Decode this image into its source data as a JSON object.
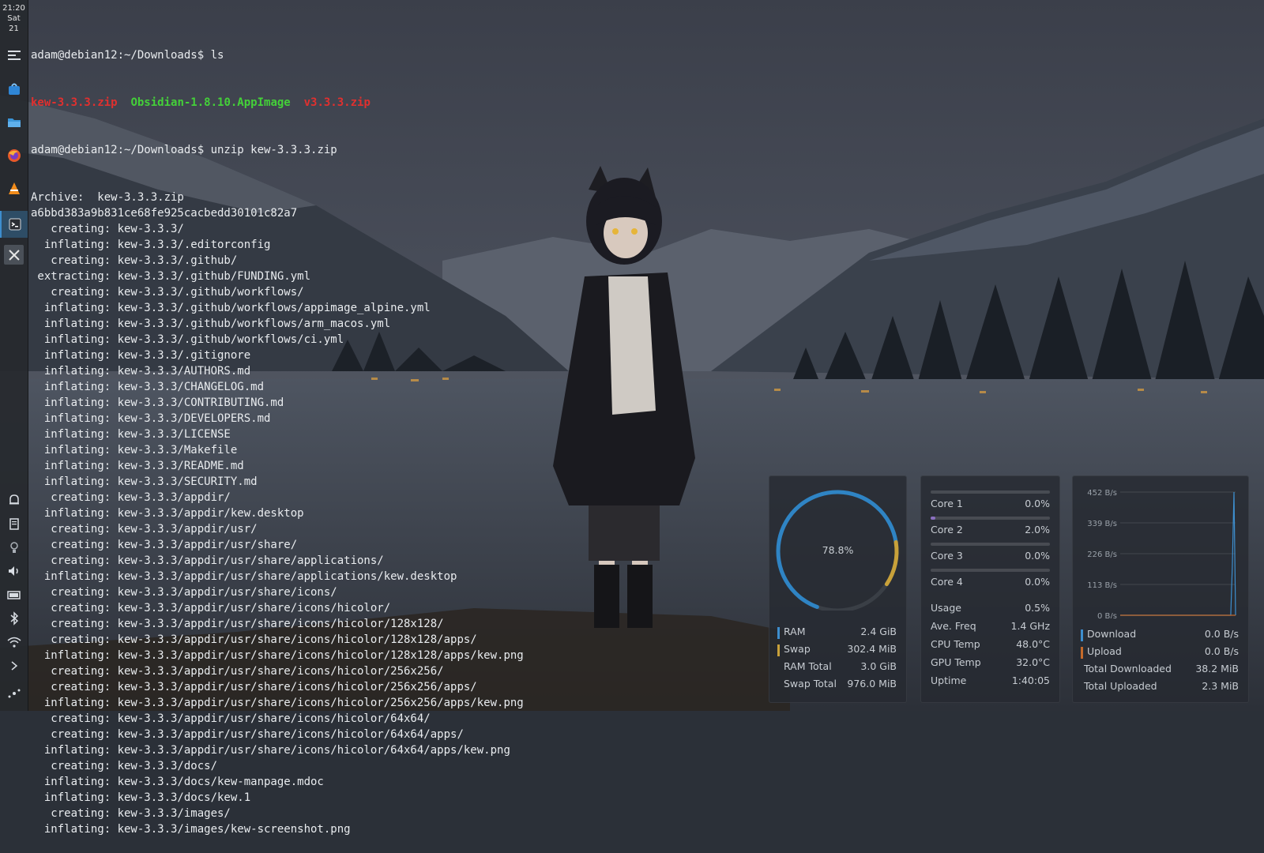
{
  "panel": {
    "clock": {
      "time": "21:20",
      "day": "Sat",
      "date": "21"
    },
    "launchers": [
      {
        "icon": "taskbar-settings-icon"
      },
      {
        "icon": "software-store-icon"
      },
      {
        "icon": "file-manager-icon"
      },
      {
        "icon": "firefox-icon"
      },
      {
        "icon": "vlc-icon"
      },
      {
        "icon": "terminal-icon"
      },
      {
        "icon": "xsnow-icon"
      }
    ],
    "tray": [
      {
        "icon": "notifications-icon"
      },
      {
        "icon": "clipboard-icon"
      },
      {
        "icon": "night-light-icon"
      },
      {
        "icon": "volume-icon"
      },
      {
        "icon": "battery-icon"
      },
      {
        "icon": "bluetooth-icon"
      },
      {
        "icon": "wifi-icon"
      },
      {
        "icon": "expand-tray-icon"
      },
      {
        "icon": "power-menu-icon"
      }
    ]
  },
  "terminal": {
    "prompt": "adam@debian12:~/Downloads$ ",
    "cmd_ls": "ls",
    "ls_output": [
      "kew-3.3.3.zip",
      "Obsidian-1.8.10.AppImage",
      "v3.3.3.zip"
    ],
    "cmd_unzip": "unzip kew-3.3.3.zip",
    "lines": [
      "Archive:  kew-3.3.3.zip",
      "a6bbd383a9b831ce68fe925cacbedd30101c82a7",
      "   creating: kew-3.3.3/",
      "  inflating: kew-3.3.3/.editorconfig",
      "   creating: kew-3.3.3/.github/",
      " extracting: kew-3.3.3/.github/FUNDING.yml",
      "   creating: kew-3.3.3/.github/workflows/",
      "  inflating: kew-3.3.3/.github/workflows/appimage_alpine.yml",
      "  inflating: kew-3.3.3/.github/workflows/arm_macos.yml",
      "  inflating: kew-3.3.3/.github/workflows/ci.yml",
      "  inflating: kew-3.3.3/.gitignore",
      "  inflating: kew-3.3.3/AUTHORS.md",
      "  inflating: kew-3.3.3/CHANGELOG.md",
      "  inflating: kew-3.3.3/CONTRIBUTING.md",
      "  inflating: kew-3.3.3/DEVELOPERS.md",
      "  inflating: kew-3.3.3/LICENSE",
      "  inflating: kew-3.3.3/Makefile",
      "  inflating: kew-3.3.3/README.md",
      "  inflating: kew-3.3.3/SECURITY.md",
      "   creating: kew-3.3.3/appdir/",
      "  inflating: kew-3.3.3/appdir/kew.desktop",
      "   creating: kew-3.3.3/appdir/usr/",
      "   creating: kew-3.3.3/appdir/usr/share/",
      "   creating: kew-3.3.3/appdir/usr/share/applications/",
      "  inflating: kew-3.3.3/appdir/usr/share/applications/kew.desktop",
      "   creating: kew-3.3.3/appdir/usr/share/icons/",
      "   creating: kew-3.3.3/appdir/usr/share/icons/hicolor/",
      "   creating: kew-3.3.3/appdir/usr/share/icons/hicolor/128x128/",
      "   creating: kew-3.3.3/appdir/usr/share/icons/hicolor/128x128/apps/",
      "  inflating: kew-3.3.3/appdir/usr/share/icons/hicolor/128x128/apps/kew.png",
      "   creating: kew-3.3.3/appdir/usr/share/icons/hicolor/256x256/",
      "   creating: kew-3.3.3/appdir/usr/share/icons/hicolor/256x256/apps/",
      "  inflating: kew-3.3.3/appdir/usr/share/icons/hicolor/256x256/apps/kew.png",
      "   creating: kew-3.3.3/appdir/usr/share/icons/hicolor/64x64/",
      "   creating: kew-3.3.3/appdir/usr/share/icons/hicolor/64x64/apps/",
      "  inflating: kew-3.3.3/appdir/usr/share/icons/hicolor/64x64/apps/kew.png",
      "   creating: kew-3.3.3/docs/",
      "  inflating: kew-3.3.3/docs/kew-manpage.mdoc",
      "  inflating: kew-3.3.3/docs/kew.1",
      "   creating: kew-3.3.3/images/",
      "  inflating: kew-3.3.3/images/kew-screenshot.png"
    ]
  },
  "memory_widget": {
    "gauge_label": "78.8%",
    "gauge_fraction": 0.788,
    "rows": [
      {
        "label": "RAM",
        "value": "2.4 GiB",
        "color": "#3d8ece"
      },
      {
        "label": "Swap",
        "value": "302.4 MiB",
        "color": "#c8a13a"
      },
      {
        "label": "RAM Total",
        "value": "3.0 GiB"
      },
      {
        "label": "Swap Total",
        "value": "976.0 MiB"
      }
    ],
    "colors": {
      "ram": "#2f84c4",
      "swap": "#c8a13a",
      "track": "#3a3f46"
    }
  },
  "cpu_widget": {
    "cores": [
      {
        "label": "Core 1",
        "value": "0.0%",
        "fraction": 0.0
      },
      {
        "label": "Core 2",
        "value": "2.0%",
        "fraction": 0.02
      },
      {
        "label": "Core 3",
        "value": "0.0%",
        "fraction": 0.0
      },
      {
        "label": "Core 4",
        "value": "0.0%",
        "fraction": 0.0
      }
    ],
    "stats": [
      {
        "label": "Usage",
        "value": "0.5%"
      },
      {
        "label": "Ave. Freq",
        "value": "1.4 GHz"
      },
      {
        "label": "CPU Temp",
        "value": "48.0°C"
      },
      {
        "label": "GPU Temp",
        "value": "32.0°C"
      },
      {
        "label": "Uptime",
        "value": "1:40:05"
      }
    ]
  },
  "network_widget": {
    "chart_data": {
      "type": "line",
      "yticks": [
        "452 B/s",
        "339 B/s",
        "226 B/s",
        "113 B/s",
        "0 B/s"
      ],
      "ylim": [
        0,
        452
      ],
      "series": [
        {
          "name": "Download",
          "values": [
            0,
            0,
            0,
            0,
            0,
            0,
            0,
            0,
            0,
            0,
            0,
            0,
            0,
            0,
            0,
            0,
            0,
            0,
            0,
            0,
            0,
            0,
            0,
            0,
            0,
            0,
            0,
            0,
            0,
            0,
            0,
            0,
            0,
            0,
            0,
            0,
            0,
            0,
            0,
            0,
            0,
            0,
            0,
            0,
            0,
            0,
            0,
            0,
            0,
            0,
            0,
            0,
            0,
            0,
            0,
            0,
            0,
            0,
            0,
            0,
            0,
            0,
            0,
            0,
            0,
            0,
            0,
            0,
            0,
            0,
            180,
            452,
            0
          ],
          "color": "#3d8ece"
        },
        {
          "name": "Upload",
          "values": [
            0,
            0,
            0,
            0,
            0,
            0,
            0,
            0,
            0,
            0,
            0,
            0,
            0,
            0,
            0,
            0,
            0,
            0,
            0,
            0,
            0,
            0,
            0,
            0,
            0,
            0,
            0,
            0,
            0,
            0,
            0,
            0,
            0,
            0,
            0,
            0,
            0,
            0,
            0,
            0,
            0,
            0,
            0,
            0,
            0,
            0,
            0,
            0,
            0,
            0,
            0,
            0,
            0,
            0,
            0,
            0,
            0,
            0,
            0,
            0,
            0,
            0,
            0,
            0,
            0,
            0,
            0,
            0,
            0,
            0,
            0,
            0,
            0
          ],
          "color": "#c56a2a"
        }
      ]
    },
    "rows": [
      {
        "label": "Download",
        "value": "0.0 B/s",
        "color": "#3d8ece"
      },
      {
        "label": "Upload",
        "value": "0.0 B/s",
        "color": "#c56a2a"
      },
      {
        "label": "Total Downloaded",
        "value": "38.2 MiB"
      },
      {
        "label": "Total Uploaded",
        "value": "2.3 MiB"
      }
    ]
  }
}
